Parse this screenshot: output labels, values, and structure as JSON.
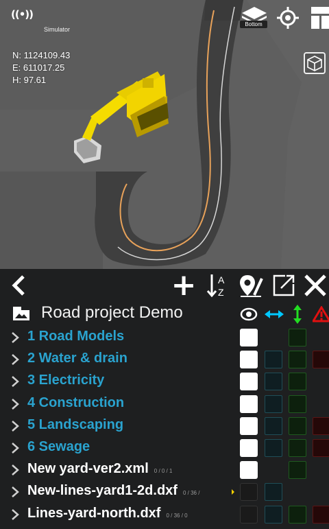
{
  "viewport": {
    "gps_icon": "signal-broadcast-icon",
    "simulator_label": "Simulator",
    "coords": {
      "north": "N: 1124109.43",
      "east": "E: 611017.25",
      "height": "H: 97.61"
    },
    "layer_view_label": "Bottom"
  },
  "toolbar": {
    "back": "chevron-left-icon",
    "add": "+",
    "sort_icon": "sort-az-icon",
    "edit_icon": "edit-point-icon",
    "open_icon": "external-open-icon",
    "close_icon": "close-icon"
  },
  "project": {
    "title": "Road project Demo"
  },
  "colors": {
    "group_text": "#2aa3cf",
    "file_text": "#ffffff",
    "horiz_accent": "#00c8ff",
    "vert_accent": "#22dd22",
    "warn_accent": "#e01010"
  },
  "rows": [
    {
      "label": "1 Road Models",
      "type": "group",
      "counts": "",
      "visible": true,
      "horiz": false,
      "vert": true,
      "warn": false,
      "flag": false
    },
    {
      "label": "2 Water & drain",
      "type": "group",
      "counts": "",
      "visible": true,
      "horiz": true,
      "vert": true,
      "warn": true,
      "flag": false
    },
    {
      "label": "3 Electricity",
      "type": "group",
      "counts": "",
      "visible": true,
      "horiz": true,
      "vert": true,
      "warn": false,
      "flag": false
    },
    {
      "label": "4 Construction",
      "type": "group",
      "counts": "",
      "visible": true,
      "horiz": true,
      "vert": true,
      "warn": false,
      "flag": false
    },
    {
      "label": "5 Landscaping",
      "type": "group",
      "counts": "",
      "visible": true,
      "horiz": true,
      "vert": true,
      "warn": true,
      "flag": false
    },
    {
      "label": "6 Sewage",
      "type": "group",
      "counts": "",
      "visible": true,
      "horiz": true,
      "vert": true,
      "warn": true,
      "flag": false
    },
    {
      "label": "New yard-ver2.xml",
      "type": "file",
      "counts": "0 / 0 / 1",
      "visible": true,
      "horiz": false,
      "vert": true,
      "warn": false,
      "flag": false
    },
    {
      "label": "New-lines-yard1-2d.dxf",
      "type": "file",
      "counts": "0 / 36 /",
      "visible": false,
      "horiz": true,
      "vert": false,
      "warn": false,
      "flag": true
    },
    {
      "label": "Lines-yard-north.dxf",
      "type": "file",
      "counts": "0 / 36 / 0",
      "visible": false,
      "horiz": true,
      "vert": true,
      "warn": true,
      "flag": false
    }
  ]
}
